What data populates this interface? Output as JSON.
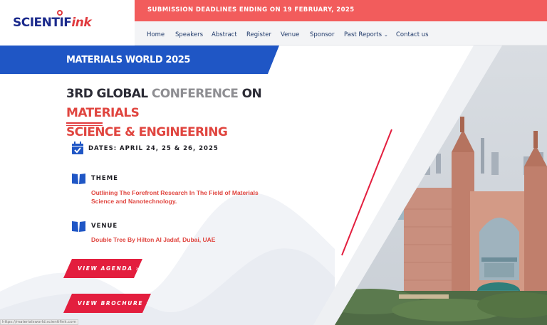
{
  "logo": {
    "part1": "SCIENTIF",
    "part2": "ink"
  },
  "announcement": "SUBMISSION DEADLINES ENDING ON 19 FEBRUARY, 2025",
  "nav": [
    {
      "label": "Home"
    },
    {
      "label": "Speakers"
    },
    {
      "label": "Abstract"
    },
    {
      "label": "Register"
    },
    {
      "label": "Venue"
    },
    {
      "label": "Sponsor"
    },
    {
      "label": "Past Reports",
      "has_dropdown": true
    },
    {
      "label": "Contact us"
    }
  ],
  "banner": "MATERIALS WORLD 2025",
  "title": {
    "part1": "3RD GLOBAL ",
    "part2": "CONFERENCE ",
    "part3": "ON ",
    "part4": "MATERIALS",
    "part5": "SCIENCE & ENGINEERING"
  },
  "dates": {
    "label": "DATES: APRIL 24, 25 & 26, 2025",
    "icon": "calendar-check-icon"
  },
  "theme": {
    "label": "THEME",
    "text": "Outlining The Forefront Research In The Field of Materials Science and Nanotechnology.",
    "icon": "open-book-icon"
  },
  "venue": {
    "label": "VENUE",
    "text": "Double Tree By Hilton Al Jadaf, Dubai, UAE",
    "icon": "open-book-icon"
  },
  "buttons": {
    "agenda": "VIEW AGENDA",
    "brochure": "VIEW BROCHURE",
    "arrow": "›"
  },
  "status_url": "https://materialsworld.scientifink.com",
  "colors": {
    "announce_bar": "#f25c5c",
    "nav_text": "#203a6a",
    "banner_blue": "#1f56c5",
    "accent_red": "#e0453f",
    "button_red": "#e31e3e",
    "logo_navy": "#1b2a8c"
  }
}
